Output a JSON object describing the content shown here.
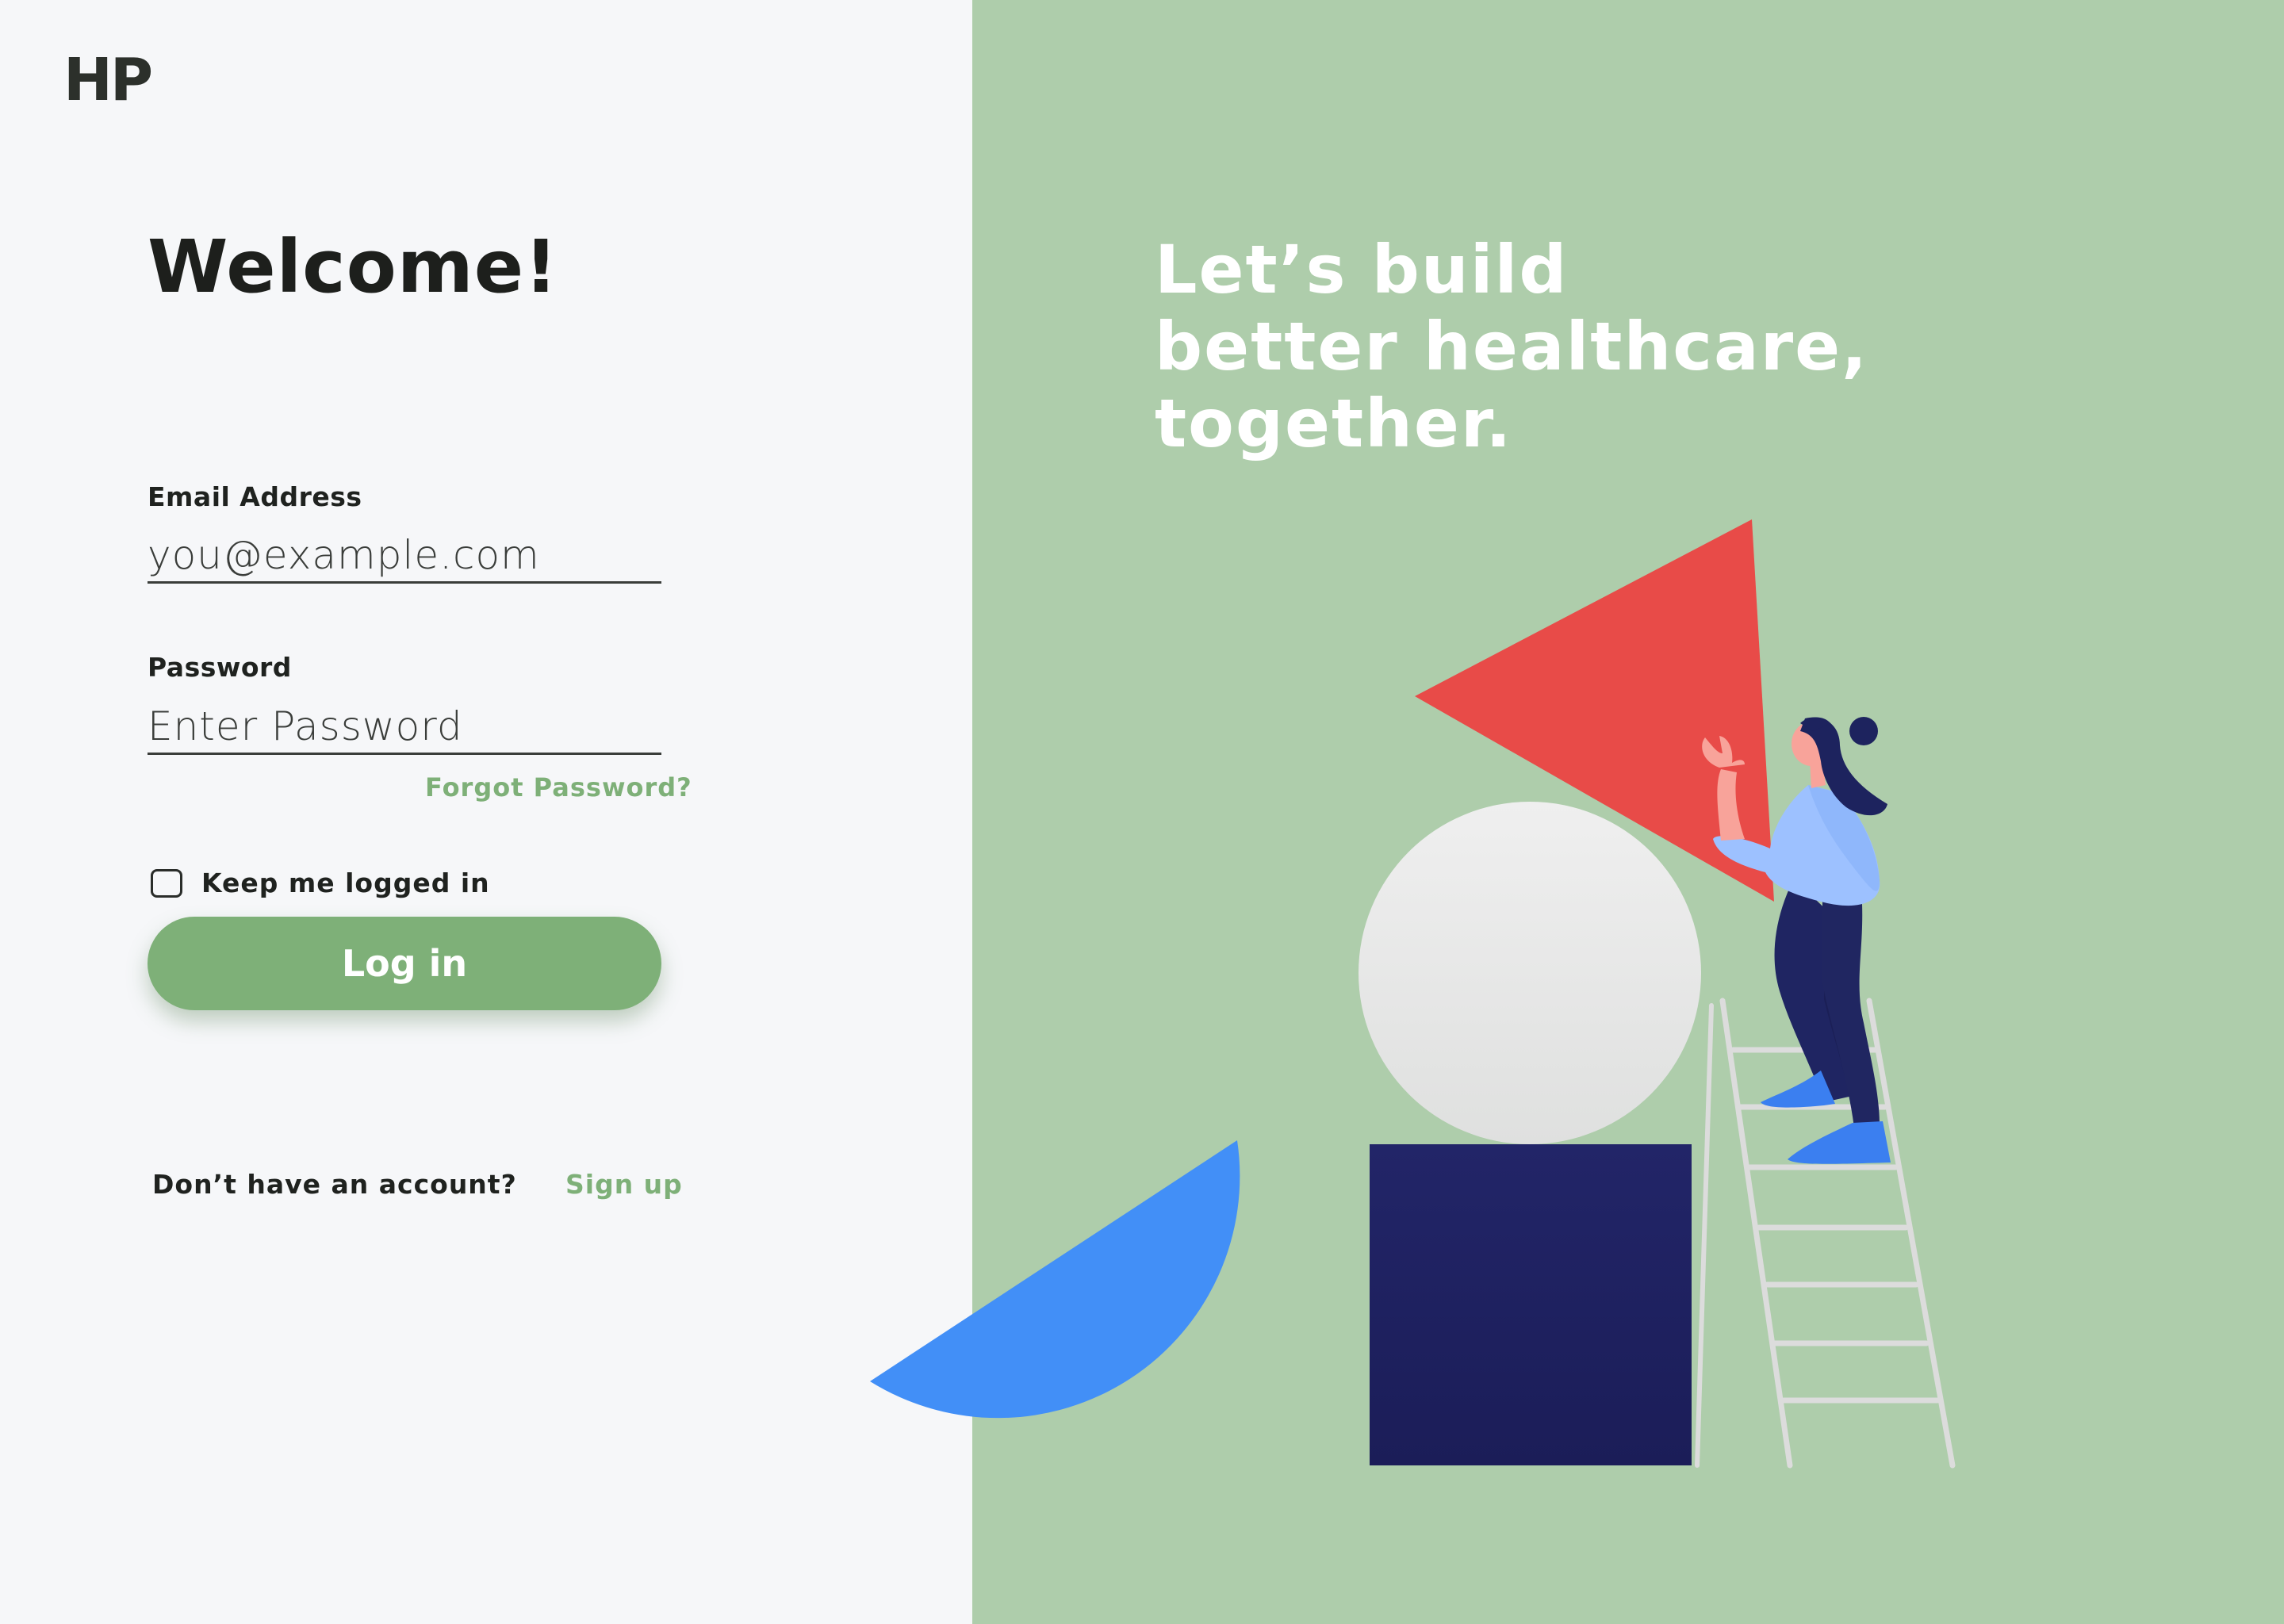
{
  "brand": {
    "logo_text": "HP"
  },
  "login": {
    "title": "Welcome!",
    "email_label": "Email Address",
    "email_placeholder": "you@example.com",
    "password_label": "Password",
    "password_placeholder": "Enter Password",
    "forgot_password": "Forgot Password?",
    "remember_label": "Keep me logged in",
    "remember_checked": false,
    "login_button": "Log in",
    "no_account_text": "Don’t have an account?",
    "signup_link": "Sign up"
  },
  "hero": {
    "tagline_lines": [
      "Let’s build",
      "better healthcare,",
      "together."
    ]
  },
  "colors": {
    "accent_green": "#7eb078",
    "panel_green": "#aecdab",
    "triangle_red": "#e84b48",
    "half_circle_blue": "#428ff7",
    "square_navy": "#1f2260",
    "sphere_grey": "#eaebeb"
  },
  "icons": {
    "checkbox": "checkbox-icon",
    "illustration": "builder-woman-on-ladder-illustration"
  }
}
